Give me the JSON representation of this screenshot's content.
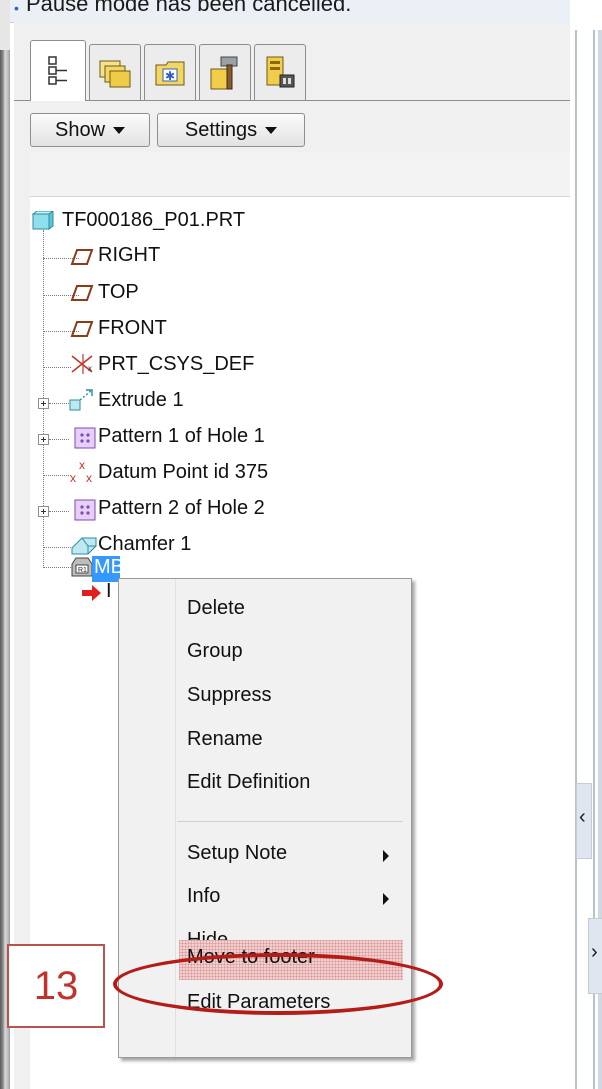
{
  "message_bar": {
    "bullet": "•",
    "text": "Pause mode has been cancelled."
  },
  "tabs": [
    {
      "icon": "model-tree-icon",
      "selected": true
    },
    {
      "icon": "folder-browser-icon",
      "selected": false
    },
    {
      "icon": "favorites-folder-icon",
      "selected": false
    },
    {
      "icon": "tool-hammer-icon",
      "selected": false
    },
    {
      "icon": "connections-icon",
      "selected": false
    }
  ],
  "toolbar": {
    "show_label": "Show",
    "settings_label": "Settings"
  },
  "tree": {
    "root": "TF000186_P01.PRT",
    "items": [
      {
        "label": "RIGHT",
        "icon": "datum-plane-icon"
      },
      {
        "label": "TOP",
        "icon": "datum-plane-icon"
      },
      {
        "label": "FRONT",
        "icon": "datum-plane-icon"
      },
      {
        "label": "PRT_CSYS_DEF",
        "icon": "coordinate-system-icon"
      },
      {
        "label": "Extrude 1",
        "icon": "extrude-icon"
      },
      {
        "label": "Pattern 1 of Hole 1",
        "icon": "pattern-icon"
      },
      {
        "label": "Datum Point id 375",
        "icon": "datum-point-icon"
      },
      {
        "label": "Pattern 2 of Hole 2",
        "icon": "pattern-icon"
      },
      {
        "label": "Chamfer 1",
        "icon": "chamfer-icon"
      },
      {
        "label": "MB",
        "icon": "annotation-feature-icon"
      },
      {
        "label": "I",
        "icon": "insert-here-arrow-icon"
      }
    ]
  },
  "context_menu": {
    "items": [
      {
        "label": "Delete"
      },
      {
        "label": "Group"
      },
      {
        "label": "Suppress"
      },
      {
        "label": "Rename"
      },
      {
        "label": "Edit Definition"
      },
      {
        "label": "Setup Note",
        "submenu": true
      },
      {
        "label": "Info",
        "submenu": true
      },
      {
        "label": "Hide"
      },
      {
        "label": "Move to footer",
        "highlighted": true
      },
      {
        "label": "Edit Parameters"
      }
    ]
  },
  "annotation": {
    "step_number": "13"
  },
  "sash_arrows": {
    "upper": "‹",
    "lower": "›"
  },
  "colors": {
    "selection": "#3399ff",
    "annotation_red": "#b41c18",
    "plane_brown": "#8b3a1a",
    "insert_arrow": "#e02020"
  }
}
